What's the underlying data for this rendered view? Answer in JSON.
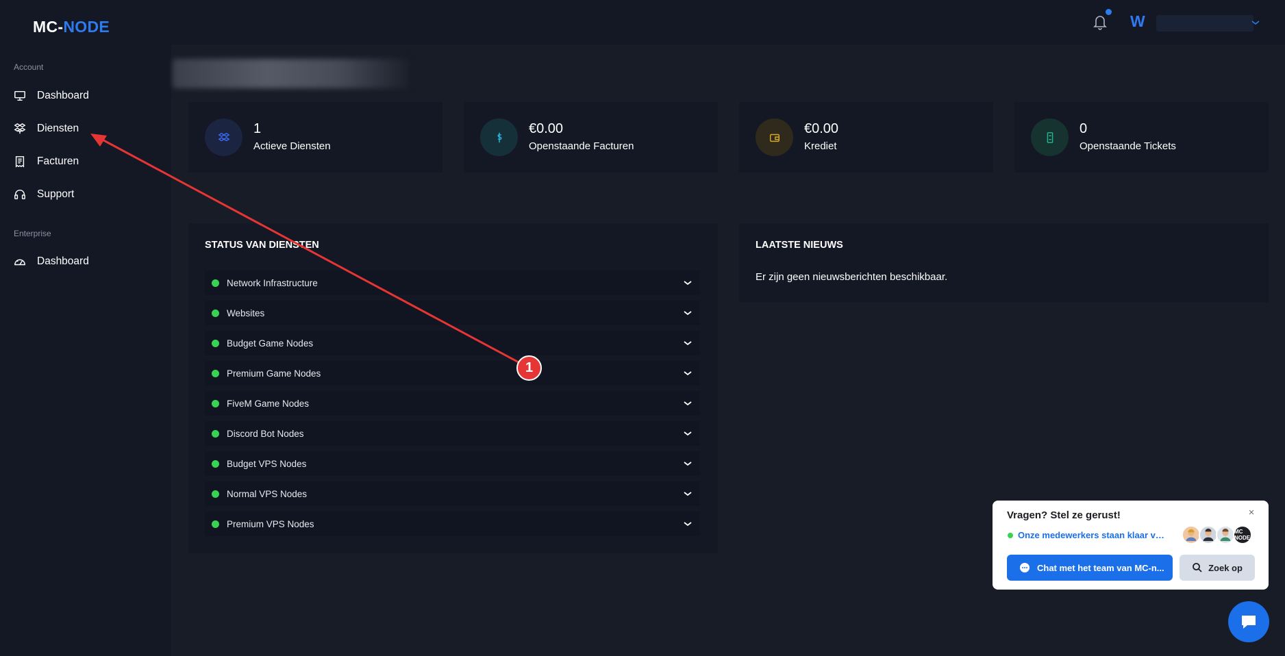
{
  "brand": {
    "logo_prefix": "MC-",
    "logo_suffix": "NODE",
    "accent_color": "#2e7bf0"
  },
  "sidebar": {
    "sections": [
      {
        "label": "Account",
        "items": [
          {
            "label": "Dashboard",
            "icon": "monitor-icon"
          },
          {
            "label": "Diensten",
            "icon": "boxes-icon"
          },
          {
            "label": "Facturen",
            "icon": "invoice-icon"
          },
          {
            "label": "Support",
            "icon": "headset-icon"
          }
        ]
      },
      {
        "label": "Enterprise",
        "items": [
          {
            "label": "Dashboard",
            "icon": "gauge-icon"
          }
        ]
      }
    ]
  },
  "topbar": {
    "user_initial": "W",
    "notification_dot": true
  },
  "stats": [
    {
      "value": "1",
      "label": "Actieve Diensten",
      "icon": "boxes-icon",
      "color": "#3b6cf5"
    },
    {
      "value": "€0.00",
      "label": "Openstaande Facturen",
      "icon": "dollar-icon",
      "color": "#2fb4d8"
    },
    {
      "value": "€0.00",
      "label": "Krediet",
      "icon": "wallet-icon",
      "color": "#d9a826"
    },
    {
      "value": "0",
      "label": "Openstaande Tickets",
      "icon": "ticket-icon",
      "color": "#22b78d"
    }
  ],
  "services_panel": {
    "title": "STATUS VAN DIENSTEN",
    "rows": [
      {
        "name": "Network Infrastructure",
        "status": "online"
      },
      {
        "name": "Websites",
        "status": "online"
      },
      {
        "name": "Budget Game Nodes",
        "status": "online"
      },
      {
        "name": "Premium Game Nodes",
        "status": "online"
      },
      {
        "name": "FiveM Game Nodes",
        "status": "online"
      },
      {
        "name": "Discord Bot Nodes",
        "status": "online"
      },
      {
        "name": "Budget VPS Nodes",
        "status": "online"
      },
      {
        "name": "Normal VPS Nodes",
        "status": "online"
      },
      {
        "name": "Premium VPS Nodes",
        "status": "online"
      }
    ]
  },
  "news_panel": {
    "title": "LAATSTE NIEUWS",
    "empty_text": "Er zijn geen nieuwsberichten beschikbaar."
  },
  "annotation": {
    "number": "1",
    "color": "#e53535"
  },
  "chat_widget": {
    "title": "Vragen? Stel ze gerust!",
    "status": "Onze medewerkers staan klaar voor ...",
    "agent_logo": "MC NODE",
    "chat_button": "Chat met het team van MC-n...",
    "search_button": "Zoek op",
    "close": "×"
  }
}
